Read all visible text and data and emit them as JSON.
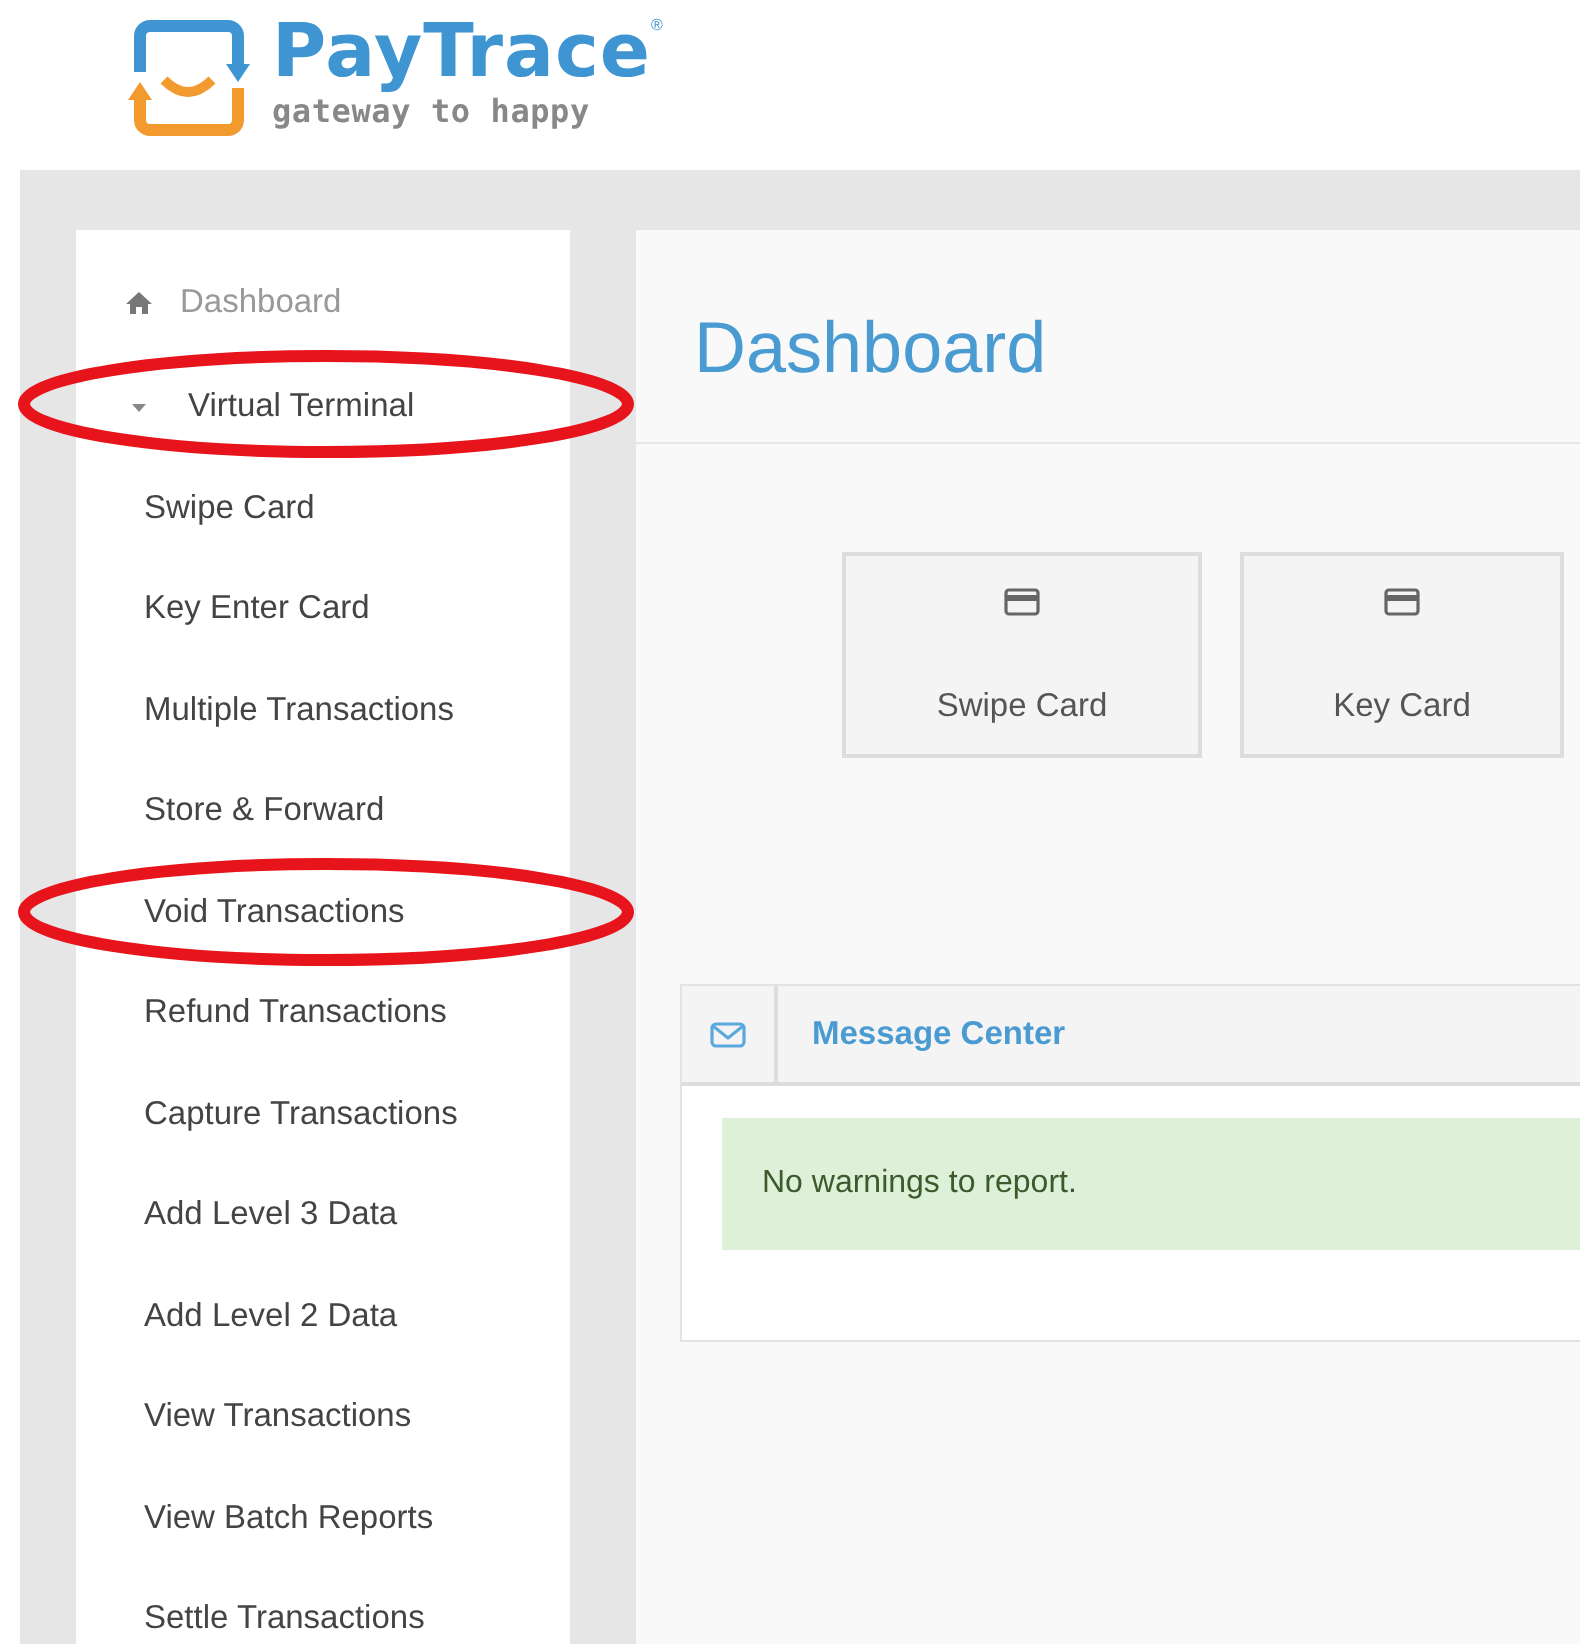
{
  "logo": {
    "brand": "PayTrace",
    "mark": "®",
    "tagline": "gateway to happy"
  },
  "sidebar": {
    "items": [
      {
        "label": "Dashboard",
        "kind": "home",
        "selected": false,
        "circled": false
      },
      {
        "label": "Virtual Terminal",
        "kind": "section",
        "expanded": true,
        "selected": false,
        "circled": true,
        "children": [
          {
            "label": "Swipe Card",
            "circled": false
          },
          {
            "label": "Key Enter Card",
            "circled": false
          },
          {
            "label": "Multiple Transactions",
            "circled": false
          },
          {
            "label": "Store & Forward",
            "circled": false
          },
          {
            "label": "Void Transactions",
            "circled": true
          },
          {
            "label": "Refund Transactions",
            "circled": false
          },
          {
            "label": "Capture Transactions",
            "circled": false
          },
          {
            "label": "Add Level 3 Data",
            "circled": false
          },
          {
            "label": "Add Level 2 Data",
            "circled": false
          },
          {
            "label": "View Transactions",
            "circled": false
          },
          {
            "label": "View Batch Reports",
            "circled": false
          },
          {
            "label": "Settle Transactions",
            "circled": false
          }
        ]
      }
    ]
  },
  "page_title": "Dashboard",
  "quick_actions": [
    {
      "label": "Swipe Card"
    },
    {
      "label": "Key Card"
    }
  ],
  "message_center": {
    "title": "Message Center",
    "alert": "No warnings to report."
  }
}
